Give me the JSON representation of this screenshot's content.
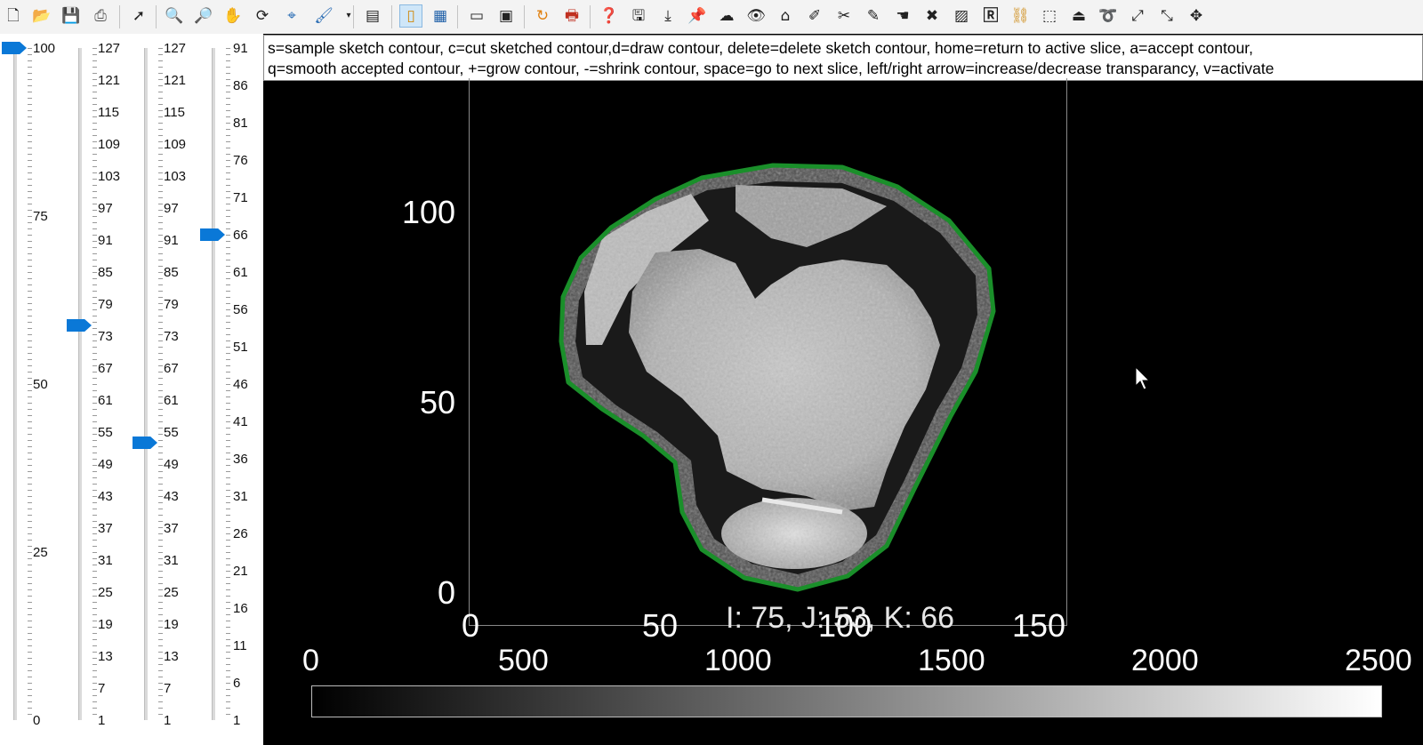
{
  "toolbar": {
    "icons": [
      "new-file-icon",
      "open-folder-icon",
      "save-icon",
      "print-preview-icon",
      "pointer-icon",
      "zoom-in-icon",
      "zoom-out-icon",
      "pan-hand-icon",
      "rotate-icon",
      "data-cursor-icon",
      "brush-icon",
      "figure-window-icon",
      "colorbar-toggle-icon",
      "legend-toggle-icon",
      "window-icon",
      "maximize-icon",
      "refresh-icon",
      "print-icon",
      "help-icon",
      "save-disk-icon",
      "download-icon",
      "pin-icon",
      "ghost-icon",
      "eye-icon",
      "home-icon",
      "eyedropper-icon",
      "scissors-icon",
      "pen-icon",
      "hand-icon",
      "delete-x-icon",
      "image-icon",
      "r-icon",
      "link-icon",
      "crop-icon",
      "iron-icon",
      "lasso-icon",
      "expand-icon",
      "shrink-icon",
      "move-icon"
    ]
  },
  "instructions": {
    "line1": "s=sample sketch contour, c=cut sketched contour,d=draw contour, delete=delete sketch contour, home=return to active slice, a=accept contour,",
    "line2": "q=smooth accepted contour, +=grow contour, -=shrink contour, space=go to next slice, left/right arrow=increase/decrease transparancy, v=activate"
  },
  "sliders": [
    {
      "name": "transparency",
      "value": 100,
      "ticks": [
        "100",
        "75",
        "50",
        "25",
        "0"
      ],
      "min": 0,
      "max": 100,
      "level": 1.0
    },
    {
      "name": "slice-i",
      "value": 75,
      "ticks": [
        "127",
        "121",
        "115",
        "109",
        "103",
        "97",
        "91",
        "85",
        "79",
        "73",
        "67",
        "61",
        "55",
        "49",
        "43",
        "37",
        "31",
        "25",
        "19",
        "13",
        "7",
        "1"
      ],
      "min": 1,
      "max": 127
    },
    {
      "name": "slice-j",
      "value": 53,
      "ticks": [
        "127",
        "121",
        "115",
        "109",
        "103",
        "97",
        "91",
        "85",
        "79",
        "73",
        "67",
        "61",
        "55",
        "49",
        "43",
        "37",
        "31",
        "25",
        "19",
        "13",
        "7",
        "1"
      ],
      "min": 1,
      "max": 127
    },
    {
      "name": "slice-k",
      "value": 66,
      "ticks": [
        "91",
        "86",
        "81",
        "76",
        "71",
        "66",
        "61",
        "56",
        "51",
        "46",
        "41",
        "36",
        "31",
        "26",
        "21",
        "16",
        "11",
        "6",
        "1"
      ],
      "min": 1,
      "max": 91
    }
  ],
  "plot": {
    "y_ticks": [
      "100",
      "50",
      "0"
    ],
    "x_ticks": [
      "0",
      "50",
      "100",
      "150"
    ],
    "contour_color": "#1a8f2a"
  },
  "status": {
    "coords": "I: 75, J: 53, K: 66"
  },
  "colorbar": {
    "ticks": [
      "0",
      "500",
      "1000",
      "1500",
      "2000",
      "2500"
    ]
  }
}
